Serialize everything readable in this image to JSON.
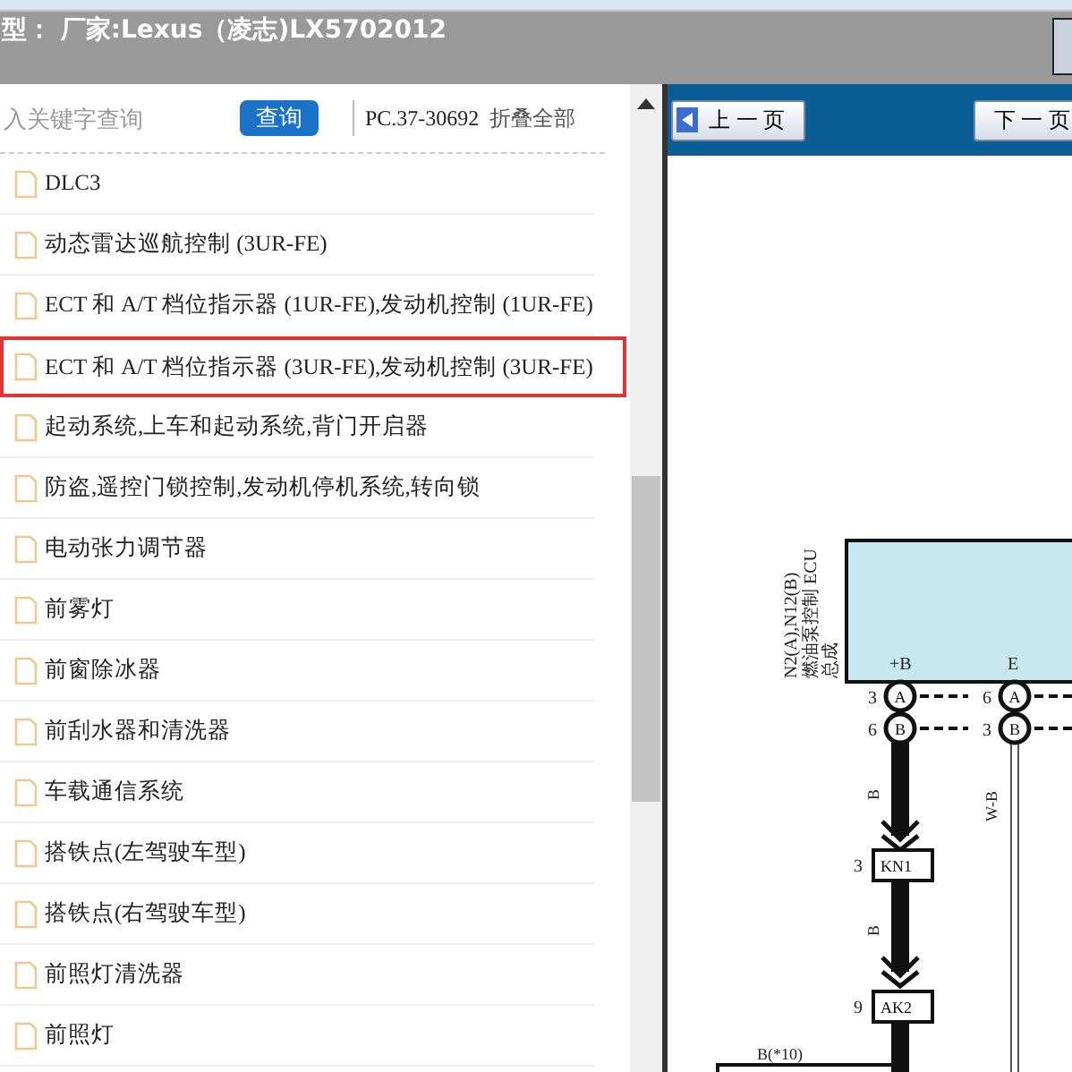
{
  "header": {
    "title": "型： 厂家:Lexus（凌志)LX5702012"
  },
  "search": {
    "placeholder": "入关键字查询",
    "button": "查询",
    "code": "PC.37-30692",
    "collapse": "折叠全部"
  },
  "items": [
    {
      "label": "DLC3",
      "selected": false
    },
    {
      "label": "动态雷达巡航控制 (3UR-FE)",
      "selected": false
    },
    {
      "label": "ECT 和 A/T 档位指示器 (1UR-FE),发动机控制 (1UR-FE)",
      "selected": false
    },
    {
      "label": "ECT 和 A/T 档位指示器 (3UR-FE),发动机控制 (3UR-FE)",
      "selected": true
    },
    {
      "label": "起动系统,上车和起动系统,背门开启器",
      "selected": false
    },
    {
      "label": "防盗,遥控门锁控制,发动机停机系统,转向锁",
      "selected": false
    },
    {
      "label": "电动张力调节器",
      "selected": false
    },
    {
      "label": "前雾灯",
      "selected": false
    },
    {
      "label": "前窗除冰器",
      "selected": false
    },
    {
      "label": "前刮水器和清洗器",
      "selected": false
    },
    {
      "label": "车载通信系统",
      "selected": false
    },
    {
      "label": "搭铁点(左驾驶车型)",
      "selected": false
    },
    {
      "label": "搭铁点(右驾驶车型)",
      "selected": false
    },
    {
      "label": "前照灯清洗器",
      "selected": false
    },
    {
      "label": "前照灯",
      "selected": false
    }
  ],
  "nav": {
    "prev": "上 一 页",
    "next": "下 一 页"
  },
  "diagram": {
    "component": [
      "N2(A),N12(B)",
      "燃油泵控制 ECU",
      "总成"
    ],
    "terminals": [
      "+B",
      "E"
    ],
    "pins": [
      {
        "number": "3",
        "letter": "A"
      },
      {
        "number": "6",
        "letter": "B"
      },
      {
        "number": "6",
        "letter": "A"
      },
      {
        "number": "3",
        "letter": "B"
      }
    ],
    "wire_colors": [
      "B",
      "B",
      "W-B"
    ],
    "connectors": [
      {
        "number": "3",
        "name": "KN1"
      },
      {
        "number": "9",
        "name": "AK2"
      }
    ],
    "branch": "B(*10)"
  }
}
